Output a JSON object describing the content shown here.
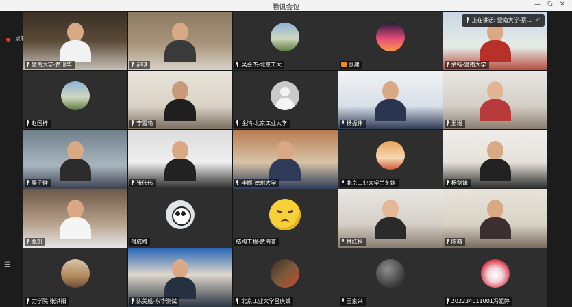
{
  "app": {
    "title": "腾讯会议"
  },
  "window_controls": {
    "minimize": "—",
    "maximize": "⧉",
    "close": "✕"
  },
  "recording": {
    "label": "录制中"
  },
  "sidebar": {
    "menu_icon": "☰"
  },
  "speaking": {
    "label": "正在讲话: 暨南大学-蔡..."
  },
  "participants": [
    {
      "name": "暨南大学-黄瑞华",
      "badge": "mic",
      "display": "camera"
    },
    {
      "name": "郝琪",
      "badge": "mic",
      "display": "camera"
    },
    {
      "name": "吴会杰-北京工大",
      "badge": "mic",
      "display": "avatar"
    },
    {
      "name": "张建",
      "badge": "user",
      "display": "avatar"
    },
    {
      "name": "余畅-暨南大学",
      "badge": "mic",
      "display": "camera"
    },
    {
      "name": "赵国梓",
      "badge": "mic",
      "display": "avatar"
    },
    {
      "name": "李雪艳",
      "badge": "mic",
      "display": "camera"
    },
    {
      "name": "金鸿-北京工业大学",
      "badge": "mic",
      "display": "avatar"
    },
    {
      "name": "杨振伟",
      "badge": "mic",
      "display": "camera"
    },
    {
      "name": "王瑶",
      "badge": "mic",
      "display": "camera"
    },
    {
      "name": "吴子健",
      "badge": "mic",
      "display": "camera"
    },
    {
      "name": "张伟伟",
      "badge": "mic",
      "display": "camera"
    },
    {
      "name": "李娜-德州大学",
      "badge": "mic",
      "display": "camera"
    },
    {
      "name": "北京工业大学兰冬婷",
      "badge": "mic",
      "display": "avatar"
    },
    {
      "name": "杨剑锋",
      "badge": "mic",
      "display": "camera"
    },
    {
      "name": "张凯",
      "badge": "mic",
      "display": "camera"
    },
    {
      "name": "时成路",
      "badge": "none",
      "display": "avatar"
    },
    {
      "name": "结构工程-黄海言",
      "badge": "none",
      "display": "emoji"
    },
    {
      "name": "林红秋",
      "badge": "mic",
      "display": "camera"
    },
    {
      "name": "陈萌",
      "badge": "mic",
      "display": "camera"
    },
    {
      "name": "力学院 张洪阳",
      "badge": "mic",
      "display": "avatar"
    },
    {
      "name": "陈美成-东华测试",
      "badge": "mic",
      "display": "camera"
    },
    {
      "name": "北京工业大学吕庆娟",
      "badge": "mic",
      "display": "avatar"
    },
    {
      "name": "王家兴",
      "badge": "mic",
      "display": "avatar"
    },
    {
      "name": "202234011001冯妮婷",
      "badge": "mic",
      "display": "avatar"
    }
  ]
}
